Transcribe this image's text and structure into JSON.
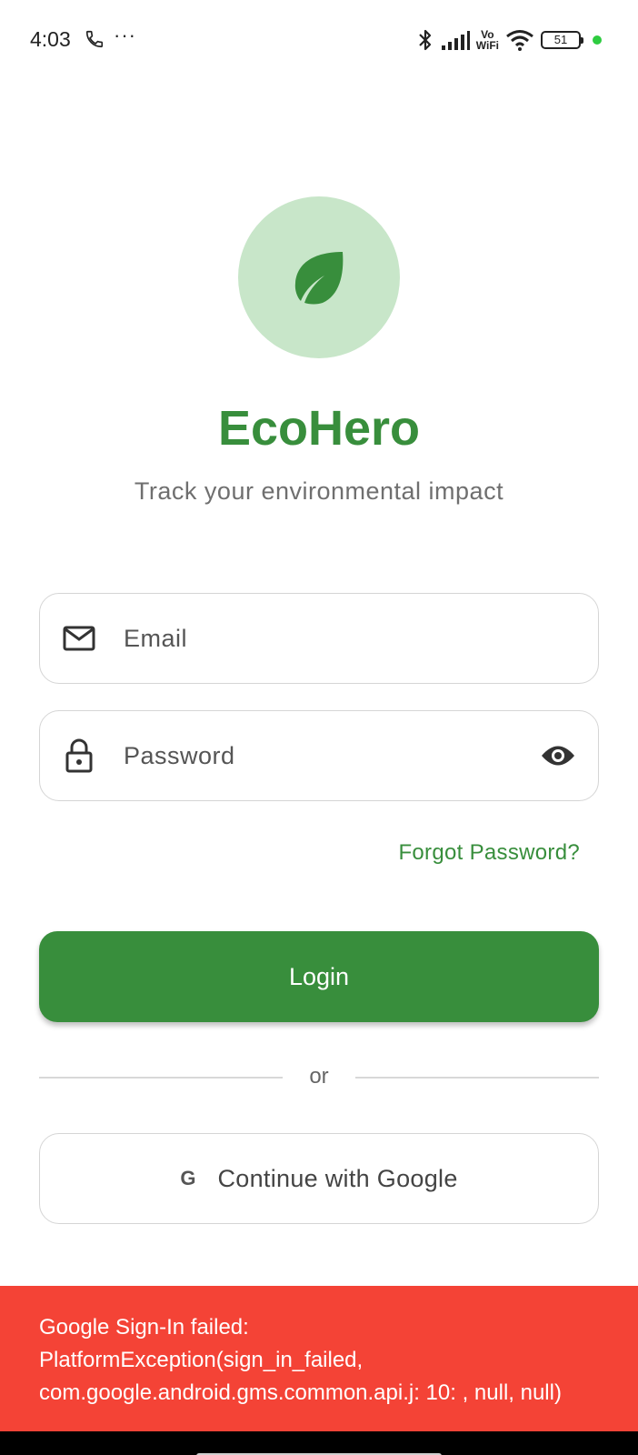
{
  "status_bar": {
    "time": "4:03",
    "more": "···",
    "volte_top": "Vo",
    "volte_bottom": "WiFi",
    "battery": "51",
    "dot_color": "#2ecc40"
  },
  "logo": {
    "icon": "leaf-icon",
    "circle_color": "#c8e6c9",
    "leaf_color": "#388e3c"
  },
  "title": "EcoHero",
  "subtitle": "Track your environmental impact",
  "email_field": {
    "icon": "mail-icon",
    "placeholder": "Email",
    "value": ""
  },
  "password_field": {
    "icon": "lock-icon",
    "placeholder": "Password",
    "value": "",
    "toggle_icon": "eye-icon"
  },
  "forgot_password": "Forgot Password?",
  "login_button": "Login",
  "divider": "or",
  "google_button": {
    "icon": "G",
    "label": "Continue with Google"
  },
  "snackbar": {
    "message": "Google Sign-In failed:\nPlatformException(sign_in_failed,\ncom.google.android.gms.common.api.j: 10: , null, null)",
    "color": "#f44336"
  },
  "accent_color": "#388e3c"
}
